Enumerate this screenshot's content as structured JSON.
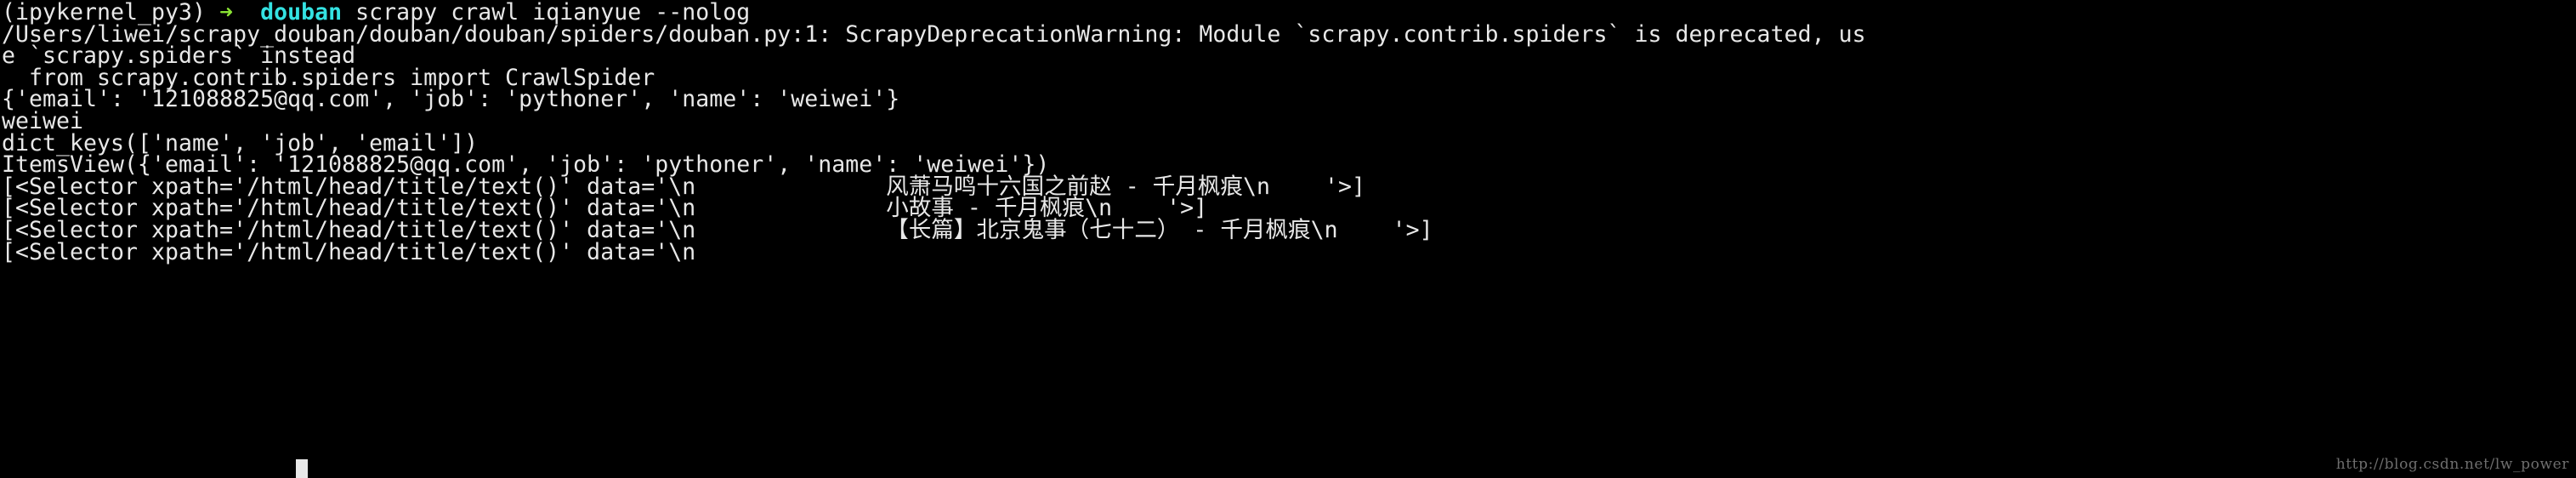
{
  "terminal": {
    "background_color": "#000000",
    "foreground_color": "#e8e8e8",
    "accent_green": "#8ae234",
    "accent_cyan": "#34e2e2",
    "prompt": {
      "env": "(ipykernel_py3)",
      "arrow": "➜",
      "directory": "douban",
      "command": "scrapy crawl iqianyue --nolog"
    },
    "lines": [
      "/Users/liwei/scrapy_douban/douban/douban/spiders/douban.py:1: ScrapyDeprecationWarning: Module `scrapy.contrib.spiders` is deprecated, us",
      "e `scrapy.spiders` instead",
      "  from scrapy.contrib.spiders import CrawlSpider",
      "{'email': '121088825@qq.com', 'job': 'pythoner', 'name': 'weiwei'}",
      "weiwei",
      "dict_keys(['name', 'job', 'email'])",
      "ItemsView({'email': '121088825@qq.com', 'job': 'pythoner', 'name': 'weiwei'})",
      "[<Selector xpath='/html/head/title/text()' data='\\n              风萧马鸣十六国之前赵 - 千月枫痕\\n    '>]",
      "[<Selector xpath='/html/head/title/text()' data='\\n              小故事 - 千月枫痕\\n    '>]",
      "[<Selector xpath='/html/head/title/text()' data='\\n              【长篇】北京鬼事（七十二） - 千月枫痕\\n    '>]",
      "[<Selector xpath='/html/head/title/text()' data='\\n"
    ],
    "watermark": "http://blog.csdn.net/lw_power"
  }
}
